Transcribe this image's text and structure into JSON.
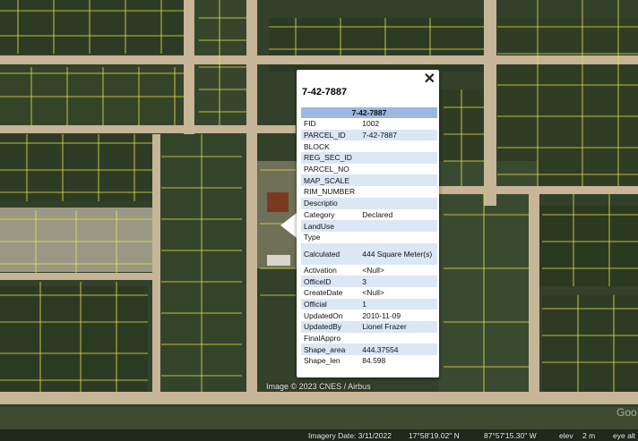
{
  "popup": {
    "title": "7-42-7887",
    "table_header": "7-42-7887",
    "close_glyph": "✕",
    "rows": [
      {
        "key": "FID",
        "value": "1002"
      },
      {
        "key": "PARCEL_ID",
        "value": "7-42-7887"
      },
      {
        "key": "BLOCK",
        "value": ""
      },
      {
        "key": "REG_SEC_ID",
        "value": ""
      },
      {
        "key": "PARCEL_NO",
        "value": ""
      },
      {
        "key": "MAP_SCALE",
        "value": ""
      },
      {
        "key": "RIM_NUMBER",
        "value": ""
      },
      {
        "key": "Descriptio",
        "value": ""
      },
      {
        "key": "Category",
        "value": "Declared"
      },
      {
        "key": "LandUse",
        "value": ""
      },
      {
        "key": "Type",
        "value": ""
      },
      {
        "key": "Calculated",
        "value": "444 Square Meter(s)"
      },
      {
        "key": "Activation",
        "value": "<Null>"
      },
      {
        "key": "OfficeID",
        "value": "3"
      },
      {
        "key": "CreateDate",
        "value": "<Null>"
      },
      {
        "key": "Official",
        "value": "1"
      },
      {
        "key": "UpdatedOn",
        "value": "2010-11-09"
      },
      {
        "key": "UpdatedBy",
        "value": "Lionel Frazer"
      },
      {
        "key": "FinalAppro",
        "value": ""
      },
      {
        "key": "Shape_area",
        "value": "444.37554"
      },
      {
        "key": "Shape_len",
        "value": "84.598"
      }
    ]
  },
  "map": {
    "image_credit": "Image © 2023 CNES / Airbus",
    "watermark": "Goo",
    "status": {
      "imagery_date": "Imagery Date: 3/11/2022",
      "latitude": "17°58'19.02\" N",
      "longitude": "87°57'15.30\" W",
      "elev_label": "elev",
      "elev_value": "2 m",
      "eye_alt": "eye alt"
    }
  },
  "colors": {
    "parcel_lines": "#e6e64a",
    "road": "#c9b79a",
    "vegetation": "#2f3d24",
    "header_bg": "#9ab8e0",
    "row_alt_bg": "#dce7f5"
  }
}
